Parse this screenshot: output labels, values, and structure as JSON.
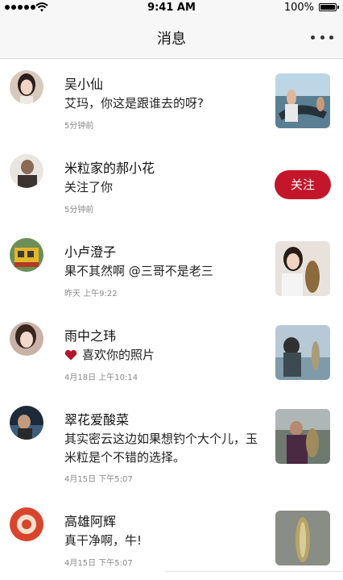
{
  "status_bar": {
    "time": "9:41 AM",
    "battery": "100%"
  },
  "nav": {
    "title": "消息"
  },
  "messages": [
    {
      "name": "吴小仙",
      "content": "艾玛，你这是跟谁去的呀?",
      "time": "5分钟前"
    },
    {
      "name": "米粒家的郝小花",
      "content": "关注了你",
      "time": "5分钟前",
      "action": "关注"
    },
    {
      "name": "小卢澄子",
      "content": "果不其然啊 @三哥不是老三",
      "time": "昨天 上午9:22"
    },
    {
      "name": "雨中之玮",
      "content": "喜欢你的照片",
      "time": "4月18日 上午10:14"
    },
    {
      "name": "翠花爱酸菜",
      "content": "其实密云这边如果想钓个大个儿，玉米粒是个不错的选择。",
      "time": "4月15日 下午5:07"
    },
    {
      "name": "高雄阿辉",
      "content": "真干净啊，牛!",
      "time": "4月15日 下午5:07"
    }
  ],
  "colors": {
    "accent": "#c4162a",
    "heart": "#b3162a",
    "nav_bg": "#f7f7f7"
  },
  "icons": {
    "more": "more-dots-icon",
    "heart": "heart-icon",
    "wifi": "wifi-icon",
    "battery": "battery-icon"
  }
}
